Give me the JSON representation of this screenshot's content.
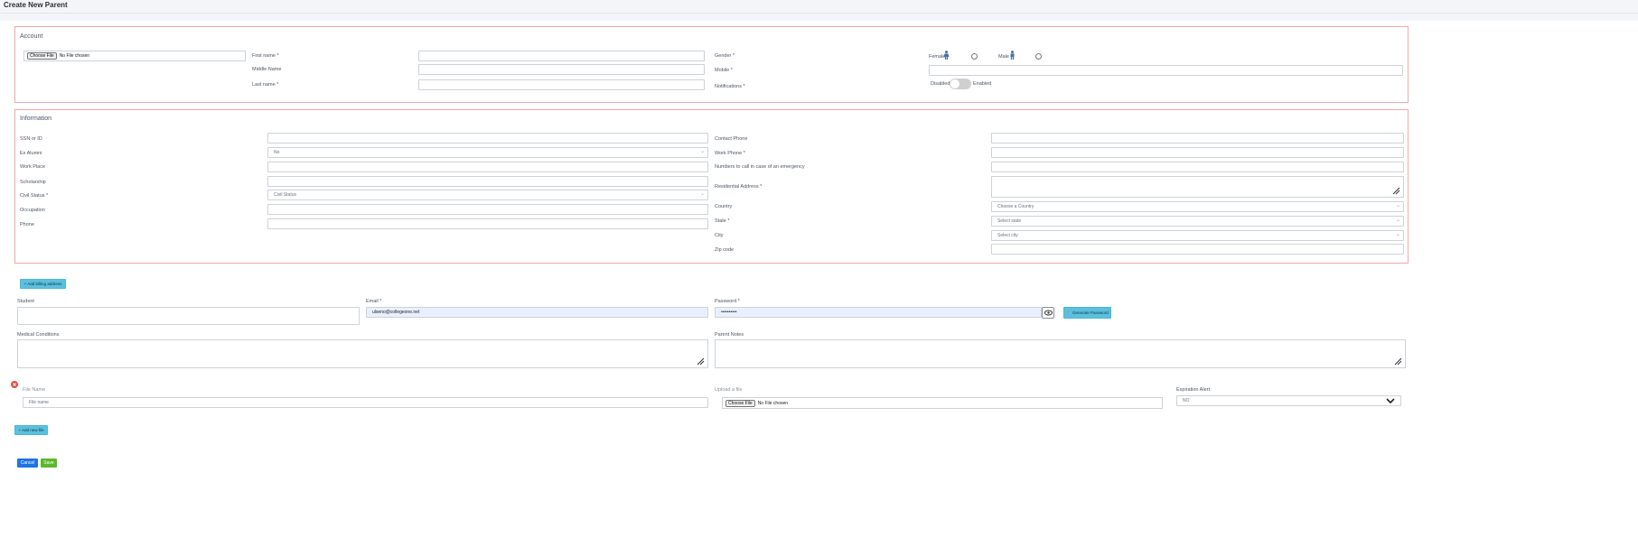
{
  "page": {
    "title": "Create New Parent"
  },
  "account": {
    "title": "Account",
    "photo_file": {
      "button": "Choose File",
      "status": "No File chosen"
    },
    "first_name_label": "First name *",
    "middle_name_label": "Middle Name",
    "last_name_label": "Last name *",
    "gender_label": "Gender *",
    "mobile_label": "Mobile *",
    "notifications_label": "Notifications *",
    "female_label": "Female",
    "male_label": "Male",
    "toggle_off_label": "Disabled",
    "toggle_on_label": "Enabled"
  },
  "information": {
    "title": "Information",
    "ssn_label": "SSN or ID",
    "ex_alumni_label": "Ex Alumni",
    "ex_alumni_value": "No",
    "work_place_label": "Work Place",
    "scholarship_label": "Scholarship",
    "civil_status_label": "Civil Status *",
    "civil_status_placeholder": "Civil Status",
    "occupation_label": "Occupation",
    "phone_label": "Phone",
    "contact_phone_label": "Contact Phone",
    "work_phone_label": "Work Phone *",
    "emergency_label": "Numbers to call in case of an emergency",
    "residential_label": "Residential Address *",
    "country_label": "Country",
    "country_placeholder": "Choose a Country",
    "state_label": "State *",
    "state_placeholder": "Select state",
    "city_label": "City",
    "city_placeholder": "Select city",
    "zip_label": "Zip code"
  },
  "extra": {
    "add_billing_label": "+ Add billing address",
    "student_label": "Student",
    "email_label": "Email *",
    "email_value": "ulseno@collegeone.net",
    "password_label": "Password *",
    "password_value": "••••••••••",
    "generate_password_label": "🔧 Generate Password",
    "medical_label": "Medical Conditions",
    "parent_notes_label": "Parent Notes"
  },
  "files": {
    "file_name_label": "File Name",
    "file_name_placeholder": "File name",
    "upload_label": "Upload a file",
    "upload_button": "Choose File",
    "upload_status": "No File chosen",
    "expiration_label": "Expiration Alert",
    "expiration_value": "NO",
    "add_new_file_label": "+ Add new file"
  },
  "actions": {
    "cancel_label": "Cancel",
    "save_label": "Save"
  },
  "colors": {
    "card_border": "#f0a8a8",
    "info_button": "#5bc0de",
    "primary": "#1e73e8",
    "success": "#5cb82a"
  },
  "icons": {
    "female": "female-icon",
    "male": "male-icon",
    "eye": "eye-icon",
    "remove": "remove-file-icon",
    "resize": "resize-grip-icon"
  }
}
